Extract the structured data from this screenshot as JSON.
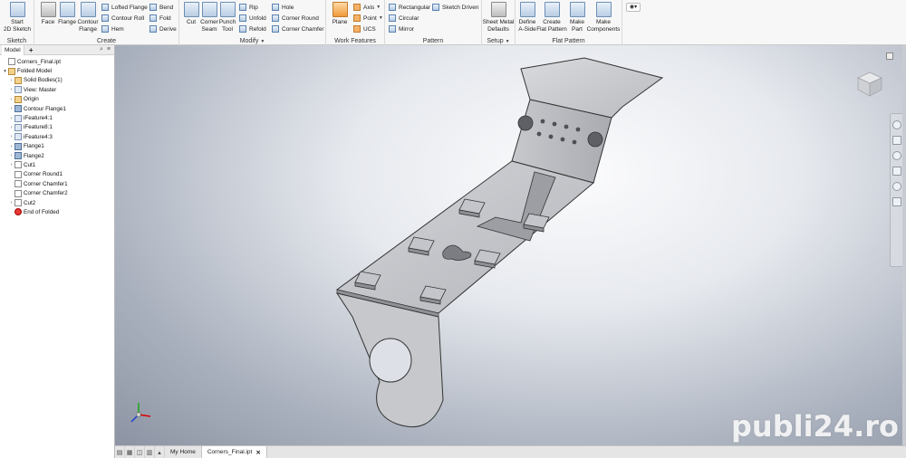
{
  "ribbon": {
    "groups": {
      "sketch": {
        "label": "Sketch",
        "start_sketch": "Start\n2D Sketch"
      },
      "create": {
        "label": "Create",
        "face": "Face",
        "flange": "Flange",
        "contour_flange": "Contour\nFlange",
        "lofted_flange": "Lofted Flange",
        "contour_roll": "Contour Roll",
        "hem": "Hem",
        "bend": "Bend",
        "fold": "Fold",
        "derive": "Derive"
      },
      "modify": {
        "label": "Modify",
        "cut": "Cut",
        "corner_seam": "Corner\nSeam",
        "punch_tool": "Punch\nTool",
        "rip": "Rip",
        "unfold": "Unfold",
        "refold": "Refold",
        "hole": "Hole",
        "corner_round": "Corner Round",
        "corner_chamfer": "Corner Chamfer"
      },
      "work_features": {
        "label": "Work Features",
        "plane": "Plane",
        "axis": "Axis",
        "point": "Point",
        "ucs": "UCS"
      },
      "pattern": {
        "label": "Pattern",
        "rectangular": "Rectangular",
        "sketch_driven": "Sketch Driven",
        "circular": "Circular",
        "mirror": "Mirror"
      },
      "setup": {
        "label": "Setup",
        "sheet_metal_defaults": "Sheet Metal\nDefaults"
      },
      "flat_pattern": {
        "label": "Flat Pattern",
        "define_a_side": "Define\nA-Side",
        "create_flat_pattern": "Create\nFlat Pattern",
        "make_part": "Make\nPart",
        "make_components": "Make\nComponents"
      }
    }
  },
  "browser": {
    "tab": "Model",
    "plus": "+",
    "items": [
      {
        "label": "Corners_Final.ipt",
        "indent": 0,
        "expander": "",
        "icon": "part-file-icon"
      },
      {
        "label": "Folded Model",
        "indent": 0,
        "expander": "▾",
        "icon": "folded-model-icon"
      },
      {
        "label": "Solid Bodies(1)",
        "indent": 1,
        "expander": "›",
        "icon": "solid-bodies-icon"
      },
      {
        "label": "View: Master",
        "indent": 1,
        "expander": "›",
        "icon": "view-icon"
      },
      {
        "label": "Origin",
        "indent": 1,
        "expander": "›",
        "icon": "origin-folder-icon"
      },
      {
        "label": "Contour Flange1",
        "indent": 1,
        "expander": "›",
        "icon": "contour-flange-icon"
      },
      {
        "label": "iFeature4:1",
        "indent": 1,
        "expander": "›",
        "icon": "ifeature-icon"
      },
      {
        "label": "iFeature8:1",
        "indent": 1,
        "expander": "›",
        "icon": "ifeature-icon"
      },
      {
        "label": "iFeature4:3",
        "indent": 1,
        "expander": "›",
        "icon": "ifeature-icon"
      },
      {
        "label": "Flange1",
        "indent": 1,
        "expander": "›",
        "icon": "flange-icon"
      },
      {
        "label": "Flange2",
        "indent": 1,
        "expander": "›",
        "icon": "flange-icon"
      },
      {
        "label": "Cut1",
        "indent": 1,
        "expander": "›",
        "icon": "cut-icon"
      },
      {
        "label": "Corner Round1",
        "indent": 1,
        "expander": "",
        "icon": "corner-round-icon"
      },
      {
        "label": "Corner Chamfer1",
        "indent": 1,
        "expander": "",
        "icon": "corner-chamfer-icon"
      },
      {
        "label": "Corner Chamfer2",
        "indent": 1,
        "expander": "",
        "icon": "corner-chamfer-icon"
      },
      {
        "label": "Cut2",
        "indent": 1,
        "expander": "›",
        "icon": "cut-icon"
      },
      {
        "label": "End of Folded",
        "indent": 1,
        "expander": "",
        "icon": "end-of-part-icon"
      }
    ]
  },
  "bottombar": {
    "tabs": [
      {
        "label": "My Home",
        "active": false
      },
      {
        "label": "Corners_Final.ipt",
        "active": true,
        "close": "✕"
      }
    ]
  },
  "watermark": "publi24.ro",
  "colors": {
    "ribbon_bg": "#f7f7f7",
    "viewport_center": "#fcfcfd",
    "viewport_edge": "#8c94a3",
    "part_face": "#c9cbd0",
    "part_edge": "#3a3a3a"
  }
}
